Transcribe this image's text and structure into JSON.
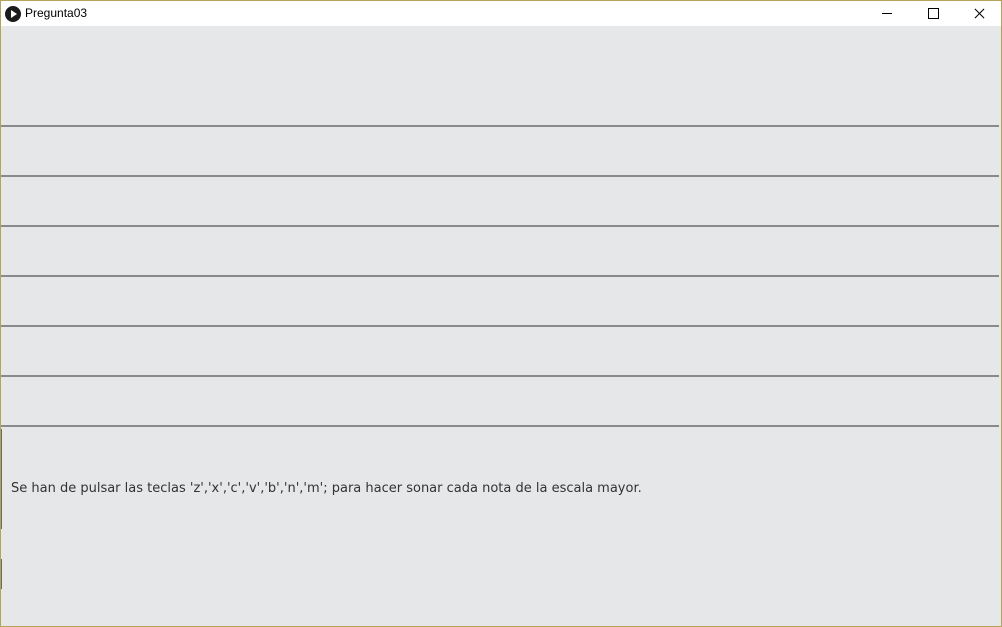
{
  "window": {
    "title": "Pregunta03",
    "icon": "processing-play-icon"
  },
  "controls": {
    "minimize_icon": "minimize-icon",
    "maximize_icon": "maximize-icon",
    "close_icon": "close-icon"
  },
  "canvas": {
    "background": "#e6e7e8",
    "line_color": "#8a8a8a",
    "instruction": "Se han de pulsar las teclas 'z','x','c','v','b','n','m'; para hacer sonar cada nota de la escala mayor."
  }
}
